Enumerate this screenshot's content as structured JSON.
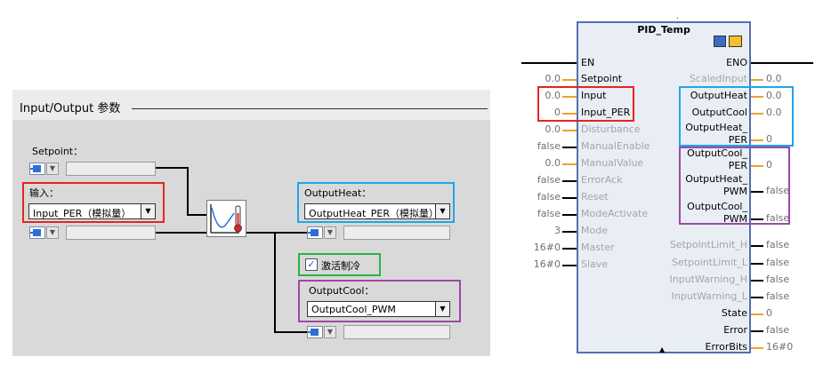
{
  "panel": {
    "title": "Input/Output 参数",
    "setpoint_label": "Setpoint：",
    "input_label": "输入：",
    "input_value": "Input_PER（模拟量）",
    "output_heat_label": "OutputHeat：",
    "output_heat_value": "OutputHeat_PER（模拟量）",
    "activate_cooling_label": "激活制冷",
    "activate_cooling_checked": true,
    "output_cool_label": "OutputCool：",
    "output_cool_value": "OutputCool_PWM"
  },
  "block": {
    "title": "PID_Temp",
    "inputs": [
      {
        "name": "EN",
        "value": ""
      },
      {
        "name": "Setpoint",
        "value": "0.0"
      },
      {
        "name": "Input",
        "value": "0.0"
      },
      {
        "name": "Input_PER",
        "value": "0"
      },
      {
        "name": "Disturbance",
        "value": "0.0"
      },
      {
        "name": "ManualEnable",
        "value": "false"
      },
      {
        "name": "ManualValue",
        "value": "0.0"
      },
      {
        "name": "ErrorAck",
        "value": "false"
      },
      {
        "name": "Reset",
        "value": "false"
      },
      {
        "name": "ModeActivate",
        "value": "false"
      },
      {
        "name": "Mode",
        "value": "3"
      },
      {
        "name": "Master",
        "value": "16#0"
      },
      {
        "name": "Slave",
        "value": "16#0"
      }
    ],
    "outputs": [
      {
        "name": "ENO",
        "value": ""
      },
      {
        "name": "ScaledInput",
        "value": "0.0"
      },
      {
        "name": "OutputHeat",
        "value": "0.0"
      },
      {
        "name": "OutputCool",
        "value": "0.0"
      },
      {
        "name": "OutputHeat_PER",
        "line1": "OutputHeat_",
        "line2": "PER",
        "value": "0"
      },
      {
        "name": "OutputCool_PER",
        "line1": "OutputCool_",
        "line2": "PER",
        "value": "0"
      },
      {
        "name": "OutputHeat_PWM",
        "line1": "OutputHeat_",
        "line2": "PWM",
        "value": "false"
      },
      {
        "name": "OutputCool_PWM",
        "line1": "OutputCool_",
        "line2": "PWM",
        "value": "false"
      },
      {
        "name": "SetpointLimit_H",
        "value": "false"
      },
      {
        "name": "SetpointLimit_L",
        "value": "false"
      },
      {
        "name": "InputWarning_H",
        "value": "false"
      },
      {
        "name": "InputWarning_L",
        "value": "false"
      },
      {
        "name": "State",
        "value": "0"
      },
      {
        "name": "Error",
        "value": "false"
      },
      {
        "name": "ErrorBits",
        "value": "16#0"
      }
    ]
  },
  "colors": {
    "red": "#e52521",
    "blue": "#1ea7e6",
    "green": "#2db24a",
    "purple": "#9b4aa6",
    "block_border": "#5470b0",
    "output_line": "#f0a030"
  }
}
